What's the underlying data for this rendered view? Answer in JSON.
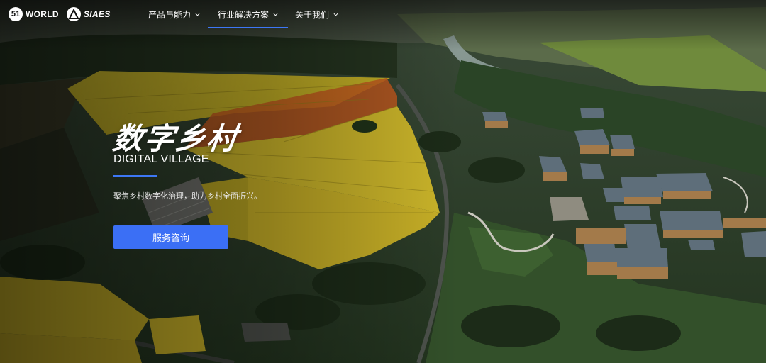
{
  "brand": {
    "logo1_mark": "51",
    "logo1_text": "WORLD",
    "logo2_text": "SIAES"
  },
  "nav": {
    "items": [
      {
        "label": "产品与能力"
      },
      {
        "label": "行业解决方案"
      },
      {
        "label": "关于我们"
      }
    ],
    "active_index": 1
  },
  "hero": {
    "title": "数字乡村",
    "subtitle": "DIGITAL VILLAGE",
    "description": "聚焦乡村数字化治理，助力乡村全面振兴。",
    "cta_label": "服务咨询"
  },
  "colors": {
    "accent": "#3b6ff5",
    "field_yellow": "#d9c22a",
    "grass_green": "#2f4a25"
  },
  "icons": [
    "chevron-down-icon",
    "siaes-logo-icon",
    "51world-logo-icon"
  ]
}
